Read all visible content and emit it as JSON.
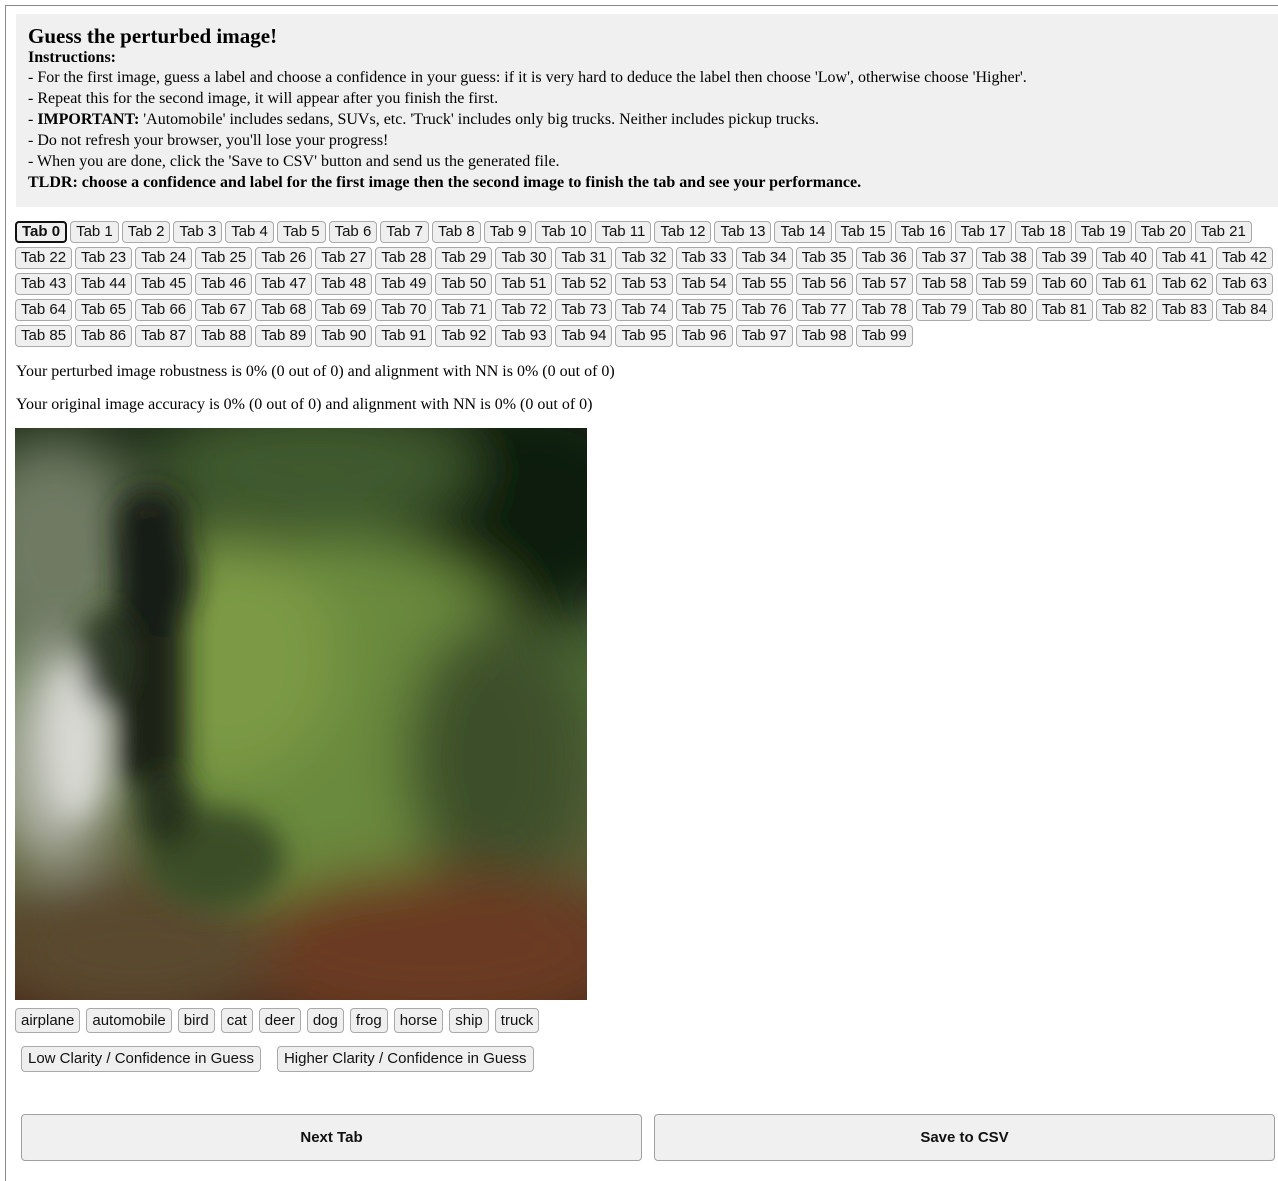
{
  "instructions": {
    "title": "Guess the perturbed image!",
    "heading": "Instructions:",
    "line1": "- For the first image, guess a label and choose a confidence in your guess: if it is very hard to deduce the label then choose 'Low', otherwise choose 'Higher'.",
    "line2": "- Repeat this for the second image, it will appear after you finish the first.",
    "line3_prefix": "- ",
    "line3_bold": "IMPORTANT:",
    "line3_rest": " 'Automobile' includes sedans, SUVs, etc. 'Truck' includes only big trucks. Neither includes pickup trucks.",
    "line4": "- Do not refresh your browser, you'll lose your progress!",
    "line5": "- When you are done, click the 'Save to CSV' button and send us the generated file.",
    "tldr": "TLDR: choose a confidence and label for the first image then the second image to finish the tab and see your performance."
  },
  "tabs": {
    "active_index": 0,
    "labels": [
      "Tab 0",
      "Tab 1",
      "Tab 2",
      "Tab 3",
      "Tab 4",
      "Tab 5",
      "Tab 6",
      "Tab 7",
      "Tab 8",
      "Tab 9",
      "Tab 10",
      "Tab 11",
      "Tab 12",
      "Tab 13",
      "Tab 14",
      "Tab 15",
      "Tab 16",
      "Tab 17",
      "Tab 18",
      "Tab 19",
      "Tab 20",
      "Tab 21",
      "Tab 22",
      "Tab 23",
      "Tab 24",
      "Tab 25",
      "Tab 26",
      "Tab 27",
      "Tab 28",
      "Tab 29",
      "Tab 30",
      "Tab 31",
      "Tab 32",
      "Tab 33",
      "Tab 34",
      "Tab 35",
      "Tab 36",
      "Tab 37",
      "Tab 38",
      "Tab 39",
      "Tab 40",
      "Tab 41",
      "Tab 42",
      "Tab 43",
      "Tab 44",
      "Tab 45",
      "Tab 46",
      "Tab 47",
      "Tab 48",
      "Tab 49",
      "Tab 50",
      "Tab 51",
      "Tab 52",
      "Tab 53",
      "Tab 54",
      "Tab 55",
      "Tab 56",
      "Tab 57",
      "Tab 58",
      "Tab 59",
      "Tab 60",
      "Tab 61",
      "Tab 62",
      "Tab 63",
      "Tab 64",
      "Tab 65",
      "Tab 66",
      "Tab 67",
      "Tab 68",
      "Tab 69",
      "Tab 70",
      "Tab 71",
      "Tab 72",
      "Tab 73",
      "Tab 74",
      "Tab 75",
      "Tab 76",
      "Tab 77",
      "Tab 78",
      "Tab 79",
      "Tab 80",
      "Tab 81",
      "Tab 82",
      "Tab 83",
      "Tab 84",
      "Tab 85",
      "Tab 86",
      "Tab 87",
      "Tab 88",
      "Tab 89",
      "Tab 90",
      "Tab 91",
      "Tab 92",
      "Tab 93",
      "Tab 94",
      "Tab 95",
      "Tab 96",
      "Tab 97",
      "Tab 98",
      "Tab 99"
    ]
  },
  "stats": {
    "perturbed": "Your perturbed image robustness is 0% (0 out of 0) and alignment with NN is 0% (0 out of 0)",
    "original": "Your original image accuracy is 0% (0 out of 0) and alignment with NN is 0% (0 out of 0)"
  },
  "labels": [
    "airplane",
    "automobile",
    "bird",
    "cat",
    "deer",
    "dog",
    "frog",
    "horse",
    "ship",
    "truck"
  ],
  "confidence": {
    "low": "Low Clarity / Confidence in Guess",
    "high": "Higher Clarity / Confidence in Guess"
  },
  "actions": {
    "next": "Next Tab",
    "save": "Save to CSV"
  }
}
